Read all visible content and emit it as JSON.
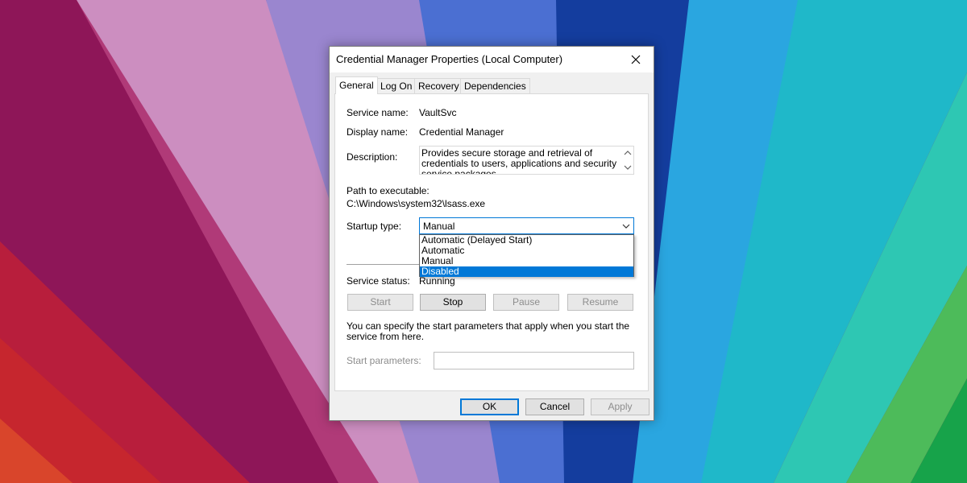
{
  "dialog": {
    "title": "Credential Manager Properties (Local Computer)",
    "tabs": [
      "General",
      "Log On",
      "Recovery",
      "Dependencies"
    ],
    "active_tab": "General"
  },
  "general": {
    "service_name_label": "Service name:",
    "service_name": "VaultSvc",
    "display_name_label": "Display name:",
    "display_name": "Credential Manager",
    "description_label": "Description:",
    "description": "Provides secure storage and retrieval of credentials to users, applications and security service packages.",
    "path_label": "Path to executable:",
    "path": "C:\\Windows\\system32\\lsass.exe",
    "startup_label": "Startup type:",
    "startup_value": "Manual",
    "startup_options": [
      "Automatic (Delayed Start)",
      "Automatic",
      "Manual",
      "Disabled"
    ],
    "startup_highlighted": "Disabled",
    "status_label": "Service status:",
    "status_value": "Running",
    "buttons": {
      "start": "Start",
      "stop": "Stop",
      "pause": "Pause",
      "resume": "Resume"
    },
    "hint": "You can specify the start parameters that apply when you start the service from here.",
    "params_label": "Start parameters:",
    "params_value": ""
  },
  "footer": {
    "ok": "OK",
    "cancel": "Cancel",
    "apply": "Apply"
  },
  "colors": {
    "accent": "#0078d7",
    "dialog_bg": "#f0f0f0",
    "disabled_text": "#8d8d8d"
  }
}
